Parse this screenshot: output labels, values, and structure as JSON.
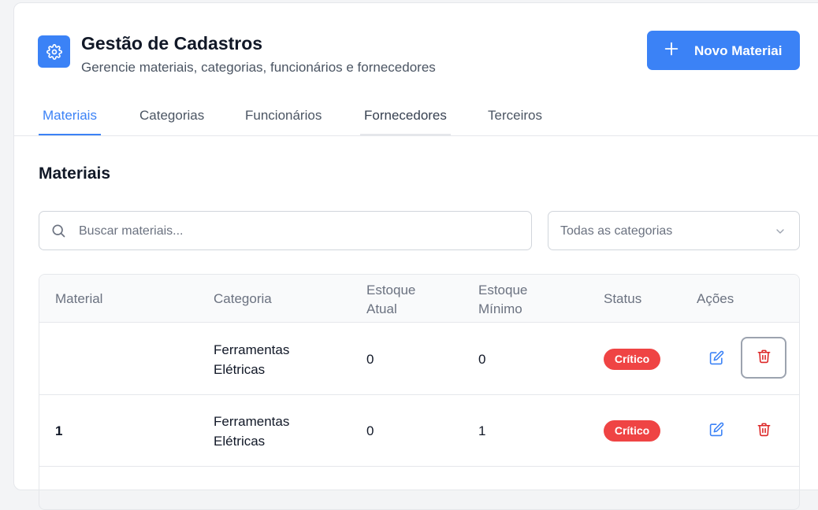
{
  "header": {
    "title": "Gestão de Cadastros",
    "subtitle": "Gerencie materiais, categorias, funcionários e fornecedores",
    "icon": "gear-icon",
    "new_button_label": "Novo Materiai",
    "accent": "#3b82f6"
  },
  "tabs": [
    {
      "label": "Materiais",
      "active": true
    },
    {
      "label": "Categorias",
      "active": false
    },
    {
      "label": "Funcionários",
      "active": false
    },
    {
      "label": "Fornecedores",
      "active": false
    },
    {
      "label": "Terceiros",
      "active": false
    }
  ],
  "section": {
    "title": "Materiais"
  },
  "search": {
    "placeholder": "Buscar materiais...",
    "value": ""
  },
  "category_filter": {
    "selected": "Todas as categorias"
  },
  "table": {
    "columns": [
      {
        "line1": "Material",
        "line2": ""
      },
      {
        "line1": "Categoria",
        "line2": ""
      },
      {
        "line1": "Estoque",
        "line2": "Atual"
      },
      {
        "line1": "Estoque",
        "line2": "Mínimo"
      },
      {
        "line1": "Status",
        "line2": ""
      },
      {
        "line1": "Ações",
        "line2": ""
      }
    ],
    "rows": [
      {
        "material": "",
        "categoria_l1": "Ferramentas",
        "categoria_l2": "Elétricas",
        "estoque_atual": "0",
        "estoque_minimo": "0",
        "status": "Crítico"
      },
      {
        "material": "1",
        "categoria_l1": "Ferramentas",
        "categoria_l2": "Elétricas",
        "estoque_atual": "0",
        "estoque_minimo": "1",
        "status": "Crítico"
      }
    ],
    "status_color": "#ef4444",
    "edit_icon": "edit-icon",
    "delete_icon": "trash-icon"
  }
}
